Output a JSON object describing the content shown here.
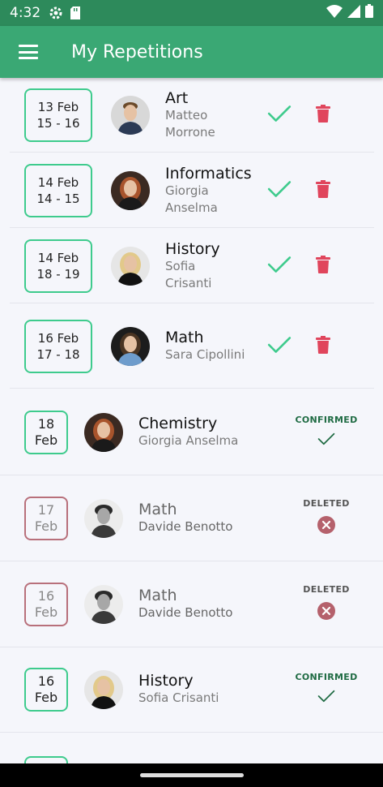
{
  "status_bar": {
    "time": "4:32"
  },
  "app_bar": {
    "title": "My Repetitions"
  },
  "upcoming": [
    {
      "date_line1": "13 Feb",
      "date_line2": "15 - 16",
      "subject": "Art",
      "teacher_line1": "Matteo",
      "teacher_line2": "Morrone",
      "avatar": "man-suit"
    },
    {
      "date_line1": "14 Feb",
      "date_line2": "14 - 15",
      "subject": "Informatics",
      "teacher_line1": "Giorgia",
      "teacher_line2": "Anselma",
      "avatar": "woman-redhair"
    },
    {
      "date_line1": "14 Feb",
      "date_line2": "18 - 19",
      "subject": "History",
      "teacher_line1": "Sofia",
      "teacher_line2": "Crisanti",
      "avatar": "woman-blonde"
    },
    {
      "date_line1": "16 Feb",
      "date_line2": "17 - 18",
      "subject": "Math",
      "teacher_line1": "Sara Cipollini",
      "teacher_line2": "",
      "avatar": "woman-dark"
    }
  ],
  "past": [
    {
      "day": "18",
      "month": "Feb",
      "subject": "Chemistry",
      "teacher": "Giorgia Anselma",
      "status": "CONFIRMED",
      "kind": "confirmed",
      "avatar": "woman-redhair"
    },
    {
      "day": "17",
      "month": "Feb",
      "subject": "Math",
      "teacher": "Davide Benotto",
      "status": "DELETED",
      "kind": "deleted",
      "avatar": "man-curly"
    },
    {
      "day": "16",
      "month": "Feb",
      "subject": "Math",
      "teacher": "Davide Benotto",
      "status": "DELETED",
      "kind": "deleted",
      "avatar": "man-curly"
    },
    {
      "day": "16",
      "month": "Feb",
      "subject": "History",
      "teacher": "Sofia Crisanti",
      "status": "CONFIRMED",
      "kind": "confirmed",
      "avatar": "woman-blonde"
    }
  ],
  "colors": {
    "app_bar": "#3aa874",
    "status_bar": "#2d8a5b",
    "accent_check": "#3ecb8d",
    "trash": "#e0455c",
    "deleted_border": "#b8707b",
    "deleted_icon": "#b5616c",
    "confirmed_label": "#1f6b43"
  }
}
